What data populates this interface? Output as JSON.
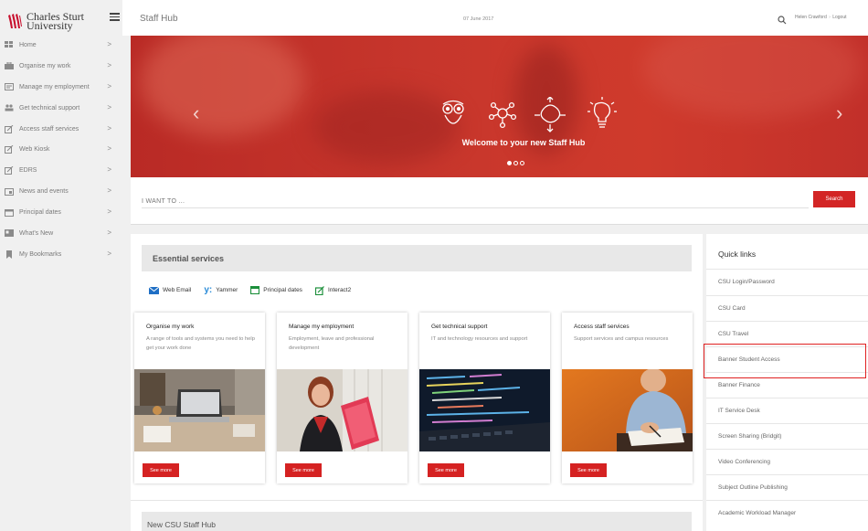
{
  "logo": {
    "line1": "Charles Sturt",
    "line2": "University",
    "color": "#c8102e"
  },
  "sidebar": {
    "items": [
      {
        "label": "Home",
        "icon": "home-grid-icon"
      },
      {
        "label": "Organise my work",
        "icon": "briefcase-icon"
      },
      {
        "label": "Manage my employment",
        "icon": "id-card-icon"
      },
      {
        "label": "Get technical support",
        "icon": "people-icon"
      },
      {
        "label": "Access staff services",
        "icon": "external-link-icon"
      },
      {
        "label": "Web Kiosk",
        "icon": "external-link-icon"
      },
      {
        "label": "EDRS",
        "icon": "external-link-icon"
      },
      {
        "label": "News and events",
        "icon": "calendar-news-icon"
      },
      {
        "label": "Principal dates",
        "icon": "calendar-icon"
      },
      {
        "label": "What's New",
        "icon": "newspaper-icon"
      },
      {
        "label": "My Bookmarks",
        "icon": "bookmark-icon"
      }
    ],
    "chevron": ">"
  },
  "topbar": {
    "title": "Staff Hub",
    "date": "07 June 2017",
    "user": "Helen Crawford",
    "logout": "Logout"
  },
  "hero": {
    "title": "Welcome to your new Staff Hub",
    "icons": [
      "owl-icon",
      "network-icon",
      "brain-arrows-icon",
      "lightbulb-icon"
    ],
    "slides": 3,
    "active_slide": 1
  },
  "iwant": {
    "placeholder": "I WANT TO ...",
    "button": "Search"
  },
  "essential": {
    "title": "Essential services",
    "links": [
      {
        "label": "Web Email",
        "icon": "mail-icon"
      },
      {
        "label": "Yammer",
        "icon": "yammer-icon"
      },
      {
        "label": "Principal dates",
        "icon": "calendar-icon"
      },
      {
        "label": "Interact2",
        "icon": "external-link-icon"
      }
    ]
  },
  "cards": [
    {
      "title": "Organise my work",
      "desc": "A range of tools and systems you need to help get your work done",
      "button": "See more",
      "image": "desk-laptop-photo"
    },
    {
      "title": "Manage my employment",
      "desc": "Employment, leave and professional development",
      "button": "See more",
      "image": "woman-folder-photo"
    },
    {
      "title": "Get technical support",
      "desc": "IT and technology resources and support",
      "button": "See more",
      "image": "code-screen-photo"
    },
    {
      "title": "Access staff services",
      "desc": "Support services and campus resources",
      "button": "See more",
      "image": "man-writing-photo"
    }
  ],
  "newhub": {
    "title": "New CSU Staff Hub"
  },
  "quicklinks": {
    "title": "Quick links",
    "items": [
      "CSU Login/Password",
      "CSU Card",
      "CSU Travel",
      "Banner Student Access",
      "Banner Finance",
      "IT Service Desk",
      "Screen Sharing (Bridgit)",
      "Video Conferencing",
      "Subject Outline Publishing",
      "Academic Workload Manager"
    ],
    "highlighted": "Banner Student Access"
  },
  "colors": {
    "accent": "#d32525",
    "hero": "#c7362c",
    "highlight": "#e02020"
  }
}
